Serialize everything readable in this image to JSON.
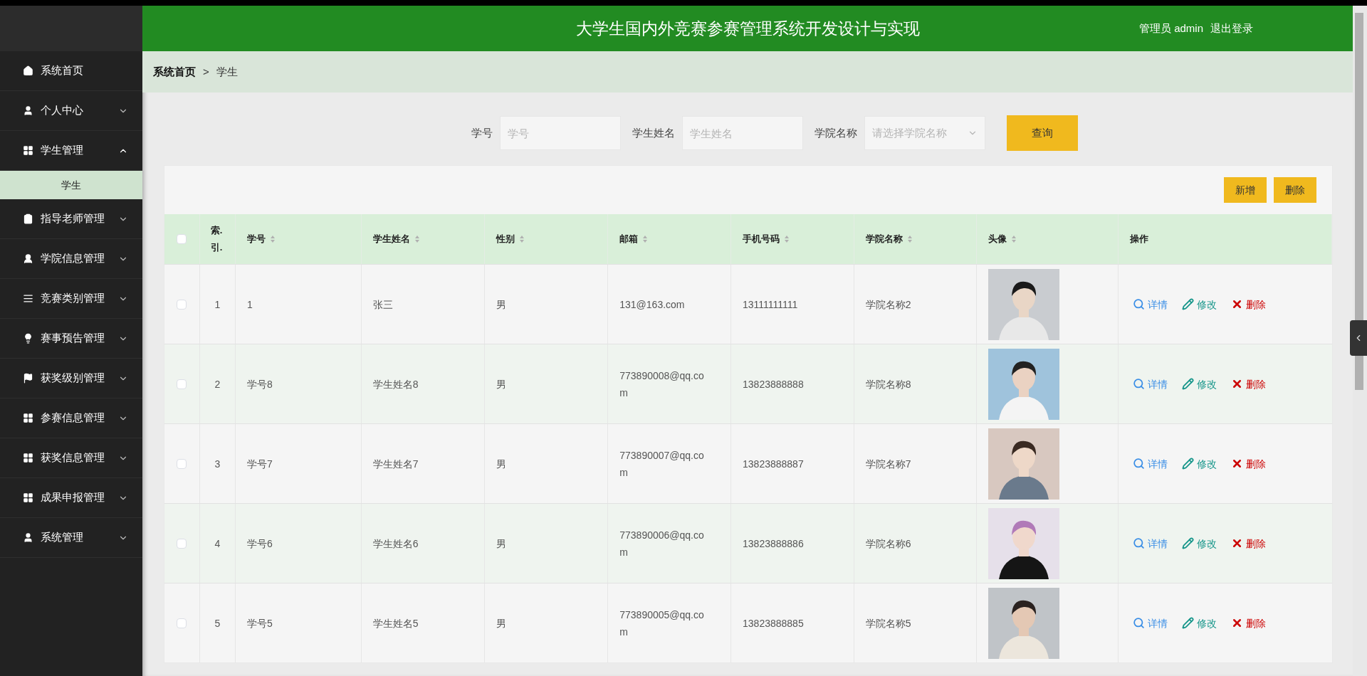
{
  "sidebar": {
    "items": [
      {
        "label": "系统首页",
        "kind": "link"
      },
      {
        "label": "个人中心",
        "kind": "menu",
        "expanded": false
      },
      {
        "label": "学生管理",
        "kind": "menu",
        "expanded": true,
        "children": [
          {
            "label": "学生",
            "selected": true
          }
        ]
      },
      {
        "label": "指导老师管理",
        "kind": "menu",
        "expanded": false
      },
      {
        "label": "学院信息管理",
        "kind": "menu",
        "expanded": false
      },
      {
        "label": "竞赛类别管理",
        "kind": "menu",
        "expanded": false
      },
      {
        "label": "赛事预告管理",
        "kind": "menu",
        "expanded": false
      },
      {
        "label": "获奖级别管理",
        "kind": "menu",
        "expanded": false
      },
      {
        "label": "参赛信息管理",
        "kind": "menu",
        "expanded": false
      },
      {
        "label": "获奖信息管理",
        "kind": "menu",
        "expanded": false
      },
      {
        "label": "成果申报管理",
        "kind": "menu",
        "expanded": false
      },
      {
        "label": "系统管理",
        "kind": "menu",
        "expanded": false
      }
    ]
  },
  "header": {
    "title": "大学生国内外竞赛参赛管理系统开发设计与实现",
    "user": "管理员 admin",
    "logout": "退出登录"
  },
  "breadcrumb": [
    {
      "label": "系统首页",
      "selected": false
    },
    {
      "label": "学生",
      "selected": true
    }
  ],
  "breadcrumb_separator": ">",
  "search": {
    "fields": [
      {
        "label": "学号",
        "placeholder": "学号",
        "kind": "input"
      },
      {
        "label": "学生姓名",
        "placeholder": "学生姓名",
        "kind": "input"
      },
      {
        "label": "学院名称",
        "placeholder": "请选择学院名称",
        "kind": "select"
      }
    ],
    "button": "查询"
  },
  "toolbar": [
    "新增",
    "删除"
  ],
  "table": {
    "columns": [
      {
        "label": "索.引.",
        "sortable": false
      },
      {
        "label": "学号",
        "sortable": true
      },
      {
        "label": "学生姓名",
        "sortable": true
      },
      {
        "label": "性别",
        "sortable": true
      },
      {
        "label": "邮箱",
        "sortable": true
      },
      {
        "label": "手机号码",
        "sortable": true
      },
      {
        "label": "学院名称",
        "sortable": true
      },
      {
        "label": "头像",
        "sortable": true
      },
      {
        "label": "操作",
        "sortable": false
      }
    ],
    "header_checked": false,
    "rows": [
      {
        "checked": false,
        "cells": [
          "1",
          "1",
          "张三",
          "男",
          "131@163.com",
          "13111111111",
          "学院名称2"
        ],
        "actions": [
          {
            "kind": "detail",
            "label": "详情"
          },
          {
            "kind": "edit",
            "label": "修改"
          },
          {
            "kind": "delete",
            "label": "删除"
          }
        ]
      },
      {
        "checked": false,
        "cells": [
          "2",
          "学号8",
          "学生姓名8",
          "男",
          "773890008@qq.com",
          "13823888888",
          "学院名称8"
        ],
        "actions": [
          {
            "kind": "detail",
            "label": "详情"
          },
          {
            "kind": "edit",
            "label": "修改"
          },
          {
            "kind": "delete",
            "label": "删除"
          }
        ]
      },
      {
        "checked": false,
        "cells": [
          "3",
          "学号7",
          "学生姓名7",
          "男",
          "773890007@qq.com",
          "13823888887",
          "学院名称7"
        ],
        "actions": [
          {
            "kind": "detail",
            "label": "详情"
          },
          {
            "kind": "edit",
            "label": "修改"
          },
          {
            "kind": "delete",
            "label": "删除"
          }
        ]
      },
      {
        "checked": false,
        "cells": [
          "4",
          "学号6",
          "学生姓名6",
          "男",
          "773890006@qq.com",
          "13823888886",
          "学院名称6"
        ],
        "actions": [
          {
            "kind": "detail",
            "label": "详情"
          },
          {
            "kind": "edit",
            "label": "修改"
          },
          {
            "kind": "delete",
            "label": "删除"
          }
        ]
      },
      {
        "checked": false,
        "cells": [
          "5",
          "学号5",
          "学生姓名5",
          "男",
          "773890005@qq.com",
          "13823888885",
          "学院名称5"
        ],
        "actions": [
          {
            "kind": "detail",
            "label": "详情"
          },
          {
            "kind": "edit",
            "label": "修改"
          },
          {
            "kind": "delete",
            "label": "删除"
          }
        ]
      }
    ]
  }
}
